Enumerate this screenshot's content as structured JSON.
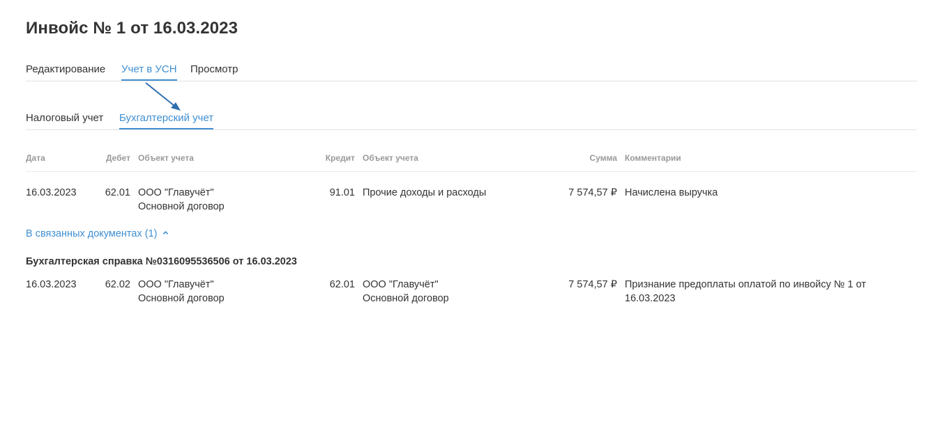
{
  "title": "Инвойс № 1 от 16.03.2023",
  "tabs": [
    {
      "label": "Редактирование",
      "active": false
    },
    {
      "label": "Учет в УСН",
      "active": true
    },
    {
      "label": "Просмотр",
      "active": false
    }
  ],
  "subtabs": [
    {
      "label": "Налоговый учет",
      "active": false
    },
    {
      "label": "Бухгалтерский учет",
      "active": true
    }
  ],
  "columns": {
    "date": "Дата",
    "debit": "Дебет",
    "debit_object": "Объект учета",
    "credit": "Кредит",
    "credit_object": "Объект учета",
    "amount": "Сумма",
    "comment": "Комментарии"
  },
  "rows": [
    {
      "date": "16.03.2023",
      "debit": "62.01",
      "debit_object": [
        "ООО \"Главучёт\"",
        "Основной договор"
      ],
      "credit": "91.01",
      "credit_object": [
        "Прочие доходы и расходы"
      ],
      "amount": "7 574,57 ₽",
      "comment": [
        "Начислена выручка"
      ]
    }
  ],
  "related": {
    "label": "В связанных документах (1)",
    "icon": "chevron-up-icon",
    "document_title": "Бухгалтерская справка №0316095536506 от 16.03.2023",
    "rows": [
      {
        "date": "16.03.2023",
        "debit": "62.02",
        "debit_object": [
          "ООО \"Главучёт\"",
          "Основной договор"
        ],
        "credit": "62.01",
        "credit_object": [
          "ООО \"Главучёт\"",
          "Основной договор"
        ],
        "amount": "7 574,57 ₽",
        "comment": [
          "Признание предоплаты оплатой по инвойсу № 1 от",
          "16.03.2023"
        ]
      }
    ]
  },
  "colors": {
    "accent": "#3f8fd2",
    "text": "#333333",
    "muted": "#999999",
    "arrow": "#2f6fae"
  }
}
